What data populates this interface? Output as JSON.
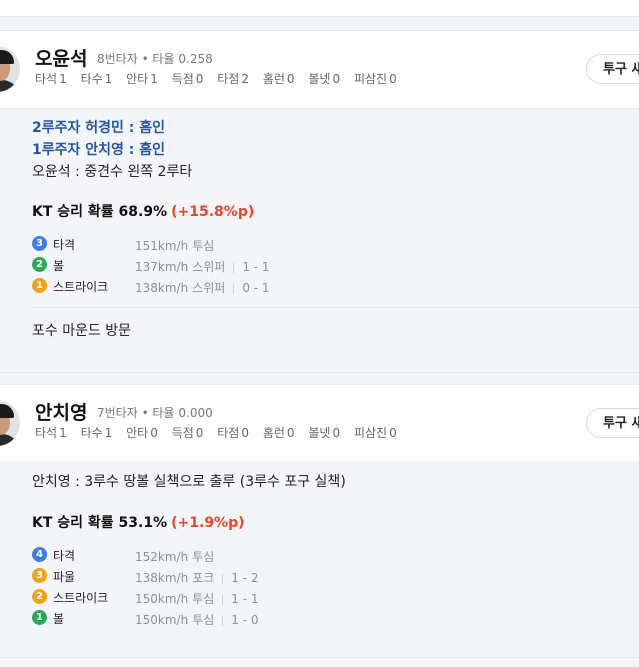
{
  "cards": [
    {
      "player_name": "오윤석",
      "batting_order": "8번타자",
      "avg_label": "타율 0.258",
      "stats": [
        {
          "label": "타석",
          "value": "1"
        },
        {
          "label": "타수",
          "value": "1"
        },
        {
          "label": "안타",
          "value": "1"
        },
        {
          "label": "득점",
          "value": "0"
        },
        {
          "label": "타점",
          "value": "2"
        },
        {
          "label": "홈런",
          "value": "0"
        },
        {
          "label": "볼넷",
          "value": "0"
        },
        {
          "label": "피삼진",
          "value": "0"
        }
      ],
      "pitch_button": "투구 새",
      "runner_events": [
        "2루주자 허경민 : 홈인",
        "1루주자 안치영 : 홈인"
      ],
      "play": "오윤석 : 중견수 왼쪽 2루타",
      "win_prob_label": "KT 승리 확률 68.9%",
      "win_prob_delta": "(+15.8%p)",
      "pitches": [
        {
          "num": "3",
          "color": "blue",
          "result": "타격",
          "speed": "151km/h",
          "type": "투심",
          "count": ""
        },
        {
          "num": "2",
          "color": "green",
          "result": "볼",
          "speed": "137km/h",
          "type": "스위퍼",
          "count": "1 - 1"
        },
        {
          "num": "1",
          "color": "orange",
          "result": "스트라이크",
          "speed": "138km/h",
          "type": "스위퍼",
          "count": "0 - 1"
        }
      ],
      "note": "포수 마운드 방문"
    },
    {
      "player_name": "안치영",
      "batting_order": "7번타자",
      "avg_label": "타율 0.000",
      "stats": [
        {
          "label": "타석",
          "value": "1"
        },
        {
          "label": "타수",
          "value": "1"
        },
        {
          "label": "안타",
          "value": "0"
        },
        {
          "label": "득점",
          "value": "0"
        },
        {
          "label": "타점",
          "value": "0"
        },
        {
          "label": "홈런",
          "value": "0"
        },
        {
          "label": "볼넷",
          "value": "0"
        },
        {
          "label": "피삼진",
          "value": "0"
        }
      ],
      "pitch_button": "투구 새",
      "play": "안치영 : 3루수 땅볼 실책으로 출루 (3루수 포구 실책)",
      "win_prob_label": "KT 승리 확률 53.1%",
      "win_prob_delta": "(+1.9%p)",
      "pitches": [
        {
          "num": "4",
          "color": "blue",
          "result": "타격",
          "speed": "152km/h",
          "type": "투심",
          "count": ""
        },
        {
          "num": "3",
          "color": "orange",
          "result": "파울",
          "speed": "138km/h",
          "type": "포크",
          "count": "1 - 2"
        },
        {
          "num": "2",
          "color": "orange",
          "result": "스트라이크",
          "speed": "150km/h",
          "type": "투심",
          "count": "1 - 1"
        },
        {
          "num": "1",
          "color": "green",
          "result": "볼",
          "speed": "150km/h",
          "type": "투심",
          "count": "1 - 0"
        }
      ]
    }
  ]
}
